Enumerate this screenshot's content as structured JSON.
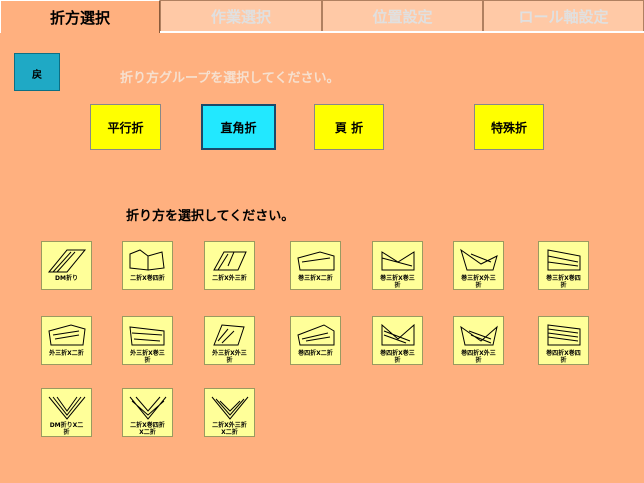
{
  "tabs": [
    "折方選択",
    "作業選択",
    "位置設定",
    "ロール軸設定"
  ],
  "back_label": "戻",
  "group_prompt": "折り方グループを選択してください。",
  "fold_prompt": "折り方を選択してください。",
  "group_buttons": [
    "平行折",
    "直角折",
    "頁 折",
    "特殊折"
  ],
  "selected_group": "直角折",
  "fold_items": [
    "DM折り",
    "二折X巻四折",
    "二折X外三折",
    "巻三折X二折",
    "巻三折X巻三\n折",
    "巻三折X外三\n折",
    "巻三折X巻四\n折",
    "外三折X二折",
    "外三折X巻三\n折",
    "外三折X外三\n折",
    "巻四折X二折",
    "巻四折X巻三\n折",
    "巻四折X外三\n折",
    "巻四折X巻四\n折",
    "DM折りX二\n折",
    "二折X巻四折\nX二折",
    "二折X外三折\nX二折"
  ]
}
